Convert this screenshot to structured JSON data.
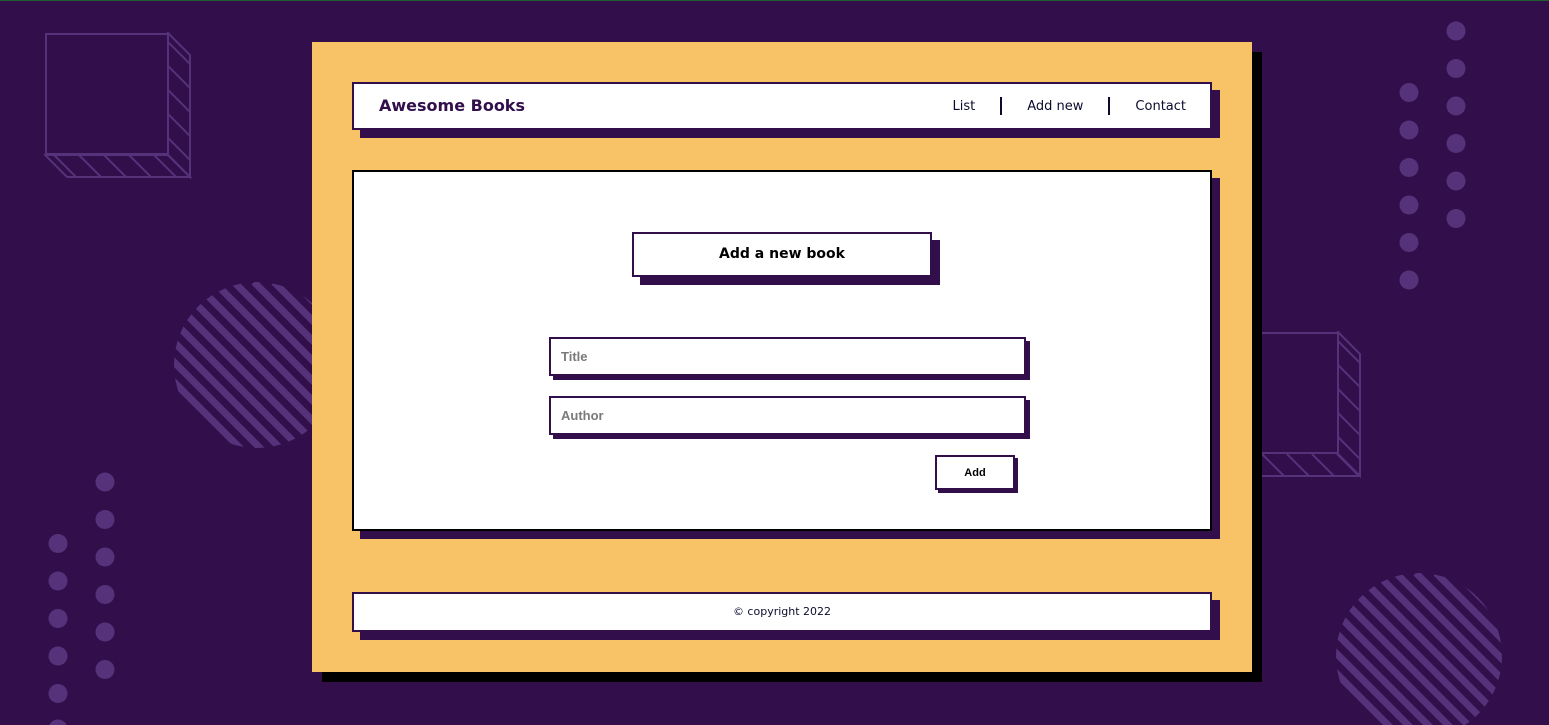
{
  "app": {
    "brand": "Awesome Books"
  },
  "nav": {
    "list_label": "List",
    "add_new_label": "Add new",
    "contact_label": "Contact"
  },
  "form": {
    "heading": "Add a new book",
    "title_placeholder": "Title",
    "title_value": "",
    "author_placeholder": "Author",
    "author_value": "",
    "add_label": "Add"
  },
  "footer": {
    "copyright": "© copyright 2022"
  },
  "colors": {
    "background": "#320f4b",
    "card": "#f8c266",
    "panel": "#ffffff",
    "shadow": "#320f4b",
    "text": "#0b0b2e"
  }
}
